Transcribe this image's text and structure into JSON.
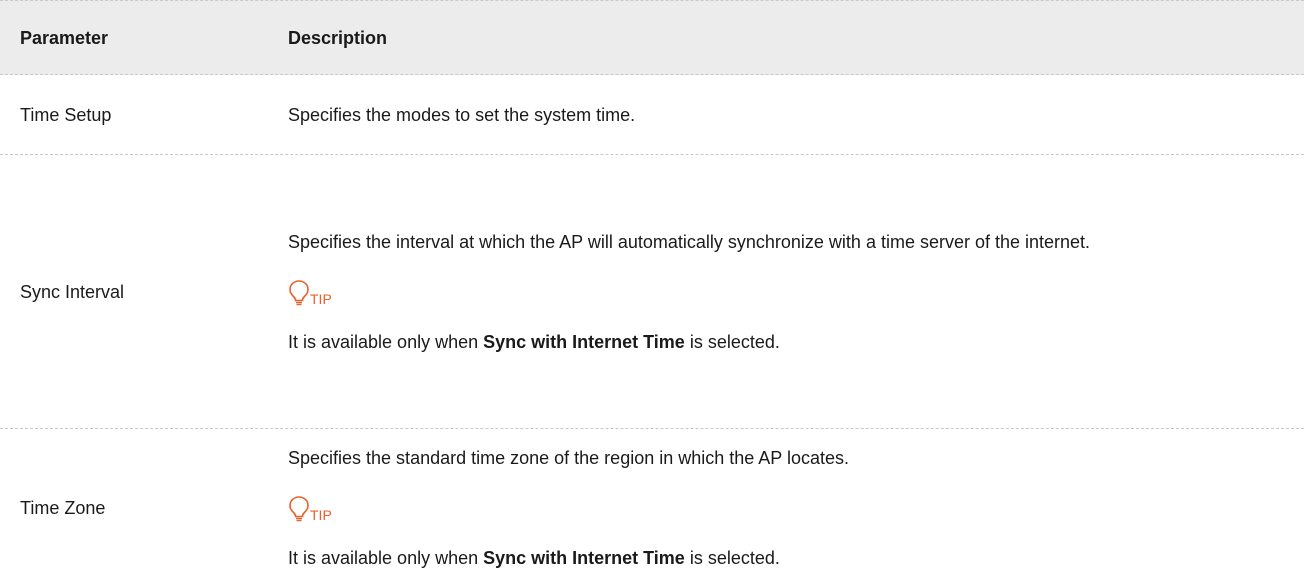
{
  "table": {
    "header": {
      "parameter": "Parameter",
      "description": "Description"
    },
    "rows": [
      {
        "parameter": "Time Setup",
        "description": "Specifies the modes to set the system time."
      },
      {
        "parameter": "Sync Interval",
        "description": "Specifies the interval at which the AP will automatically synchronize with a time server of the internet.",
        "tip_label": "TIP",
        "tip_pre": "It is available only when ",
        "tip_bold": "Sync with Internet Time",
        "tip_post": " is selected."
      },
      {
        "parameter": "Time Zone",
        "description": "Specifies the standard time zone of the region in which the AP locates.",
        "tip_label": "TIP",
        "tip_pre": "It is available only when ",
        "tip_bold": "Sync with Internet Time",
        "tip_post": " is selected."
      }
    ]
  },
  "colors": {
    "header_bg": "#ececec",
    "tip_accent": "#e8612c",
    "divider": "#c8c8c8"
  },
  "icons": {
    "tip": "lightbulb-icon"
  }
}
